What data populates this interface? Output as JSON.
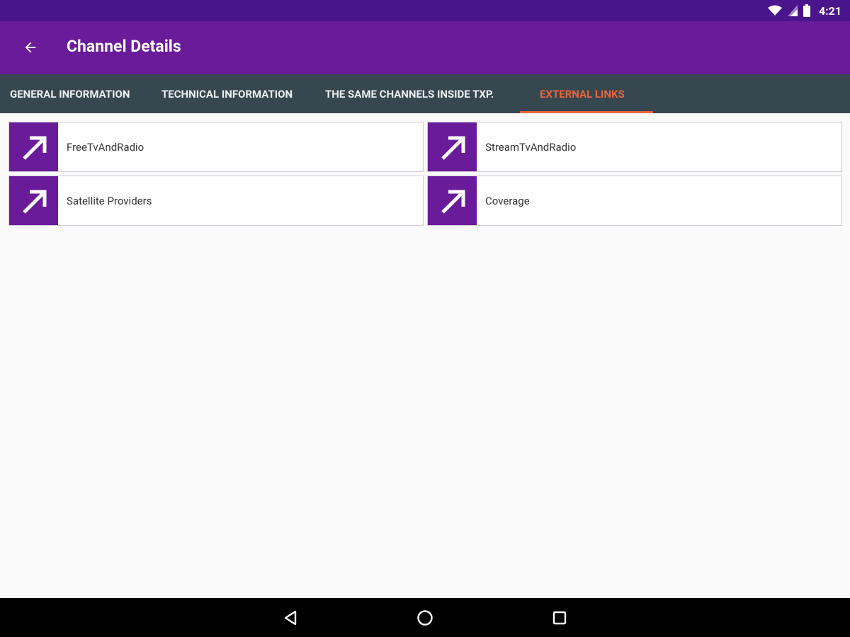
{
  "status_bar": {
    "time": "4:21",
    "icons": [
      "wifi-icon",
      "signal-icon",
      "battery-icon"
    ]
  },
  "app_bar": {
    "title": "Channel Details",
    "back_icon": "arrow-back-icon"
  },
  "tabs": [
    {
      "label": "GENERAL INFORMATION",
      "active": false
    },
    {
      "label": "TECHNICAL INFORMATION",
      "active": false
    },
    {
      "label": "THE SAME CHANNELS INSIDE TXP.",
      "active": false
    },
    {
      "label": "EXTERNAL LINKS",
      "active": true
    }
  ],
  "links": [
    {
      "label": "FreeTvAndRadio",
      "icon": "external-link-icon"
    },
    {
      "label": "StreamTvAndRadio",
      "icon": "external-link-icon"
    },
    {
      "label": "Satellite Providers",
      "icon": "external-link-icon"
    },
    {
      "label": "Coverage",
      "icon": "external-link-icon"
    }
  ],
  "nav_bar": {
    "buttons": [
      "nav-back-icon",
      "nav-home-icon",
      "nav-recents-icon"
    ]
  },
  "colors": {
    "status_bar": "#4a148c",
    "app_bar": "#6a1b9a",
    "tab_bar": "#37474f",
    "tab_active": "#e8653a",
    "link_icon_bg": "#6a1b9a"
  }
}
